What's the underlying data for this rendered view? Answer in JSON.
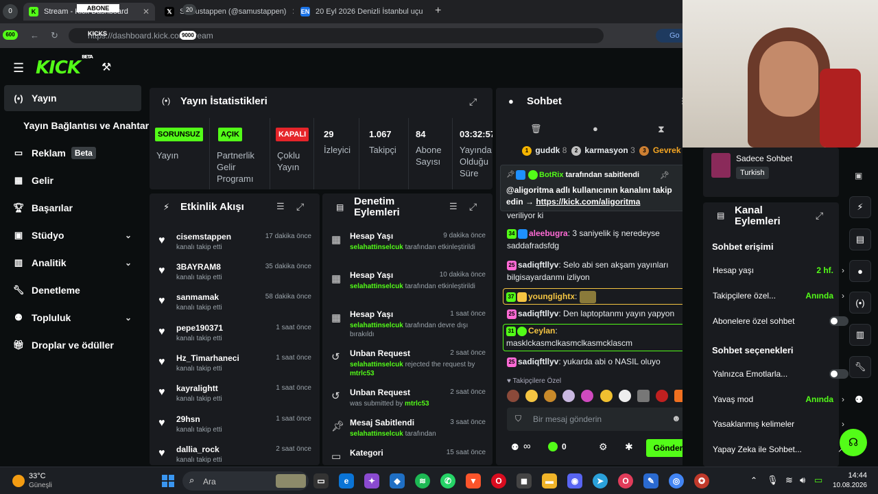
{
  "browser": {
    "tabs": [
      {
        "label": "Stream - Kick Dashboard",
        "icon": "kick-favicon"
      },
      {
        "label": "Samustappen (@samustappen)",
        "icon": "x-favicon"
      },
      {
        "label": "20 Eyl 2026 Denizli İstanbul uçu",
        "icon": "en-favicon"
      }
    ],
    "tab_counter": "0",
    "tab_counter2": "20",
    "overlay_abone": "ABONE",
    "url": "https://dashboard.kick.com/stream",
    "url_overlay_kicks": "KICKS",
    "url_overlay_num": "9000",
    "left_badge": "600",
    "extension_label": "Go"
  },
  "kick": {
    "logo": "KICK",
    "logo_beta": "BETA"
  },
  "sidebar": {
    "items": [
      {
        "label": "Yayın",
        "icon": "broadcast-icon"
      },
      {
        "label": "Yayın Bağlantısı ve Anahtarı"
      },
      {
        "label": "Reklam",
        "badge": "Beta",
        "icon": "ad-icon"
      },
      {
        "label": "Gelir",
        "icon": "revenue-icon"
      },
      {
        "label": "Başarılar",
        "icon": "trophy-icon"
      },
      {
        "label": "Stüdyo",
        "icon": "studio-icon"
      },
      {
        "label": "Analitik",
        "icon": "chart-icon"
      },
      {
        "label": "Denetleme",
        "icon": "wrench-icon"
      },
      {
        "label": "Topluluk",
        "icon": "community-icon"
      },
      {
        "label": "Droplar ve ödüller",
        "icon": "gift-icon"
      }
    ]
  },
  "stats": {
    "title": "Yayın İstatistikleri",
    "cols": [
      {
        "badge": "SORUNSUZ",
        "label": "Yayın",
        "badge_color": "#53fc18"
      },
      {
        "badge": "AÇIK",
        "label": "Partnerlik Gelir Programı",
        "badge_color": "#53fc18"
      },
      {
        "badge": "KAPALI",
        "label": "Çoklu Yayın",
        "badge_color": "#e5252a"
      },
      {
        "value": "29",
        "label": "İzleyici"
      },
      {
        "value": "1.067",
        "label": "Takipçi"
      },
      {
        "value": "84",
        "label": "Abone Sayısı"
      },
      {
        "value": "03:32:57",
        "label": "Yayında Olduğu Süre"
      }
    ]
  },
  "activity": {
    "title": "Etkinlik Akışı",
    "items": [
      {
        "name": "cisemstappen",
        "sub": "kanalı takip etti",
        "time": "17 dakika önce"
      },
      {
        "name": "3BAYRAM8",
        "sub": "kanalı takip etti",
        "time": "35 dakika önce"
      },
      {
        "name": "sanmamak",
        "sub": "kanalı takip etti",
        "time": "58 dakika önce"
      },
      {
        "name": "pepe190371",
        "sub": "kanalı takip etti",
        "time": "1 saat önce"
      },
      {
        "name": "Hz_Timarhaneci",
        "sub": "kanalı takip etti",
        "time": "1 saat önce"
      },
      {
        "name": "kayralightt",
        "sub": "kanalı takip etti",
        "time": "1 saat önce"
      },
      {
        "name": "29hsn",
        "sub": "kanalı takip etti",
        "time": "1 saat önce"
      },
      {
        "name": "dallia_rock",
        "sub": "kanalı takip etti",
        "time": "2 saat önce"
      }
    ]
  },
  "moderation": {
    "title": "Denetim Eylemleri",
    "items": [
      {
        "title": "Hesap Yaşı",
        "user": "selahattinselcuk",
        "rest": " tarafından etkinleştirildi",
        "time": "9 dakika önce",
        "icon": "calendar-icon"
      },
      {
        "title": "Hesap Yaşı",
        "user": "selahattinselcuk",
        "rest": " tarafından etkinleştirildi",
        "time": "10 dakika önce",
        "icon": "calendar-icon"
      },
      {
        "title": "Hesap Yaşı",
        "user": "selahattinselcuk",
        "rest": " tarafından devre dışı bırakıldı",
        "time": "1 saat önce",
        "icon": "calendar-icon"
      },
      {
        "title": "Unban Request",
        "user": "selahattinselcuk",
        "rest": " rejected the request by ",
        "user2": "mtrlc53",
        "time": "2 saat önce",
        "icon": "undo-icon"
      },
      {
        "title": "Unban Request",
        "pre": "was submitted by ",
        "user2": "mtrlc53",
        "time": "2 saat önce",
        "icon": "undo-icon"
      },
      {
        "title": "Mesaj Sabitlendi",
        "user": "selahattinselcuk",
        "rest": " tarafından",
        "time": "3 saat önce",
        "icon": "pin-icon"
      },
      {
        "title": "Kategori",
        "time": "15 saat önce",
        "icon": "category-icon"
      }
    ]
  },
  "chat": {
    "title": "Sohbet",
    "leaderboard": [
      {
        "rank": "1",
        "name": "guddk",
        "count": "8"
      },
      {
        "rank": "2",
        "name": "karmasyon",
        "count": "3"
      },
      {
        "rank": "3",
        "name": "Gevrek"
      }
    ],
    "pinned": {
      "by": "BotRix",
      "by_suffix": " tarafından sabitlendi",
      "text": "@aligoritma adlı kullanıcının kanalını takip edin → ",
      "link": "https://kick.com/aligoritma"
    },
    "messages": [
      {
        "user": "",
        "text": "veriliyor ki"
      },
      {
        "user": "aleebugra",
        "text": "3 saniyelik iş neredeyse saddafradsfdg",
        "color": "#ff6ad5",
        "badge": "34"
      },
      {
        "user": "sadiqftllyv",
        "text": "Selo abi sen akşam yayınları bilgisayardanmı izliyon",
        "color": "#ffffff",
        "badge": "25"
      },
      {
        "user": "younglightx",
        "text": "",
        "color": "#f5c542",
        "badge": "37"
      },
      {
        "user": "sadiqftllyv",
        "text": "Den laptoptanmı yayın yapyon",
        "color": "#ffffff",
        "badge": "25"
      },
      {
        "user": "Ceylan",
        "text": "masklckasmclkasmclkasmcklascm",
        "color": "#f5c542",
        "badge": "31"
      },
      {
        "user": "sadiqftllyv",
        "text": "yukarda abi o NASIL oluyo",
        "color": "#ffffff",
        "badge": "25"
      }
    ],
    "followers_only": "Takipçilere Özel",
    "input_placeholder": "Bir mesaj gönderin",
    "infinity_count": "0",
    "send_label": "Gönder"
  },
  "right": {
    "chat_only": "Sadece Sohbet",
    "language": "Turkish",
    "channel_actions_title": "Kanal Eylemleri",
    "chat_access_title": "Sohbet erişimi",
    "account_age_label": "Hesap yaşı",
    "account_age_value": "2 hf.",
    "followers_label": "Takipçilere özel...",
    "followers_value": "Anında",
    "subscribers_label": "Abonelere özel sohbet",
    "chat_options_title": "Sohbet seçenekleri",
    "emotes_label": "Yalnızca Emotlarla...",
    "slow_label": "Yavaş mod",
    "slow_value": "Anında",
    "banned_words_label": "Yasaklanmış kelimeler",
    "ai_label": "Yapay Zeka ile Sohbet..."
  },
  "taskbar": {
    "weather_temp": "33°C",
    "weather_desc": "Güneşli",
    "search_placeholder": "Ara",
    "time": "14:44",
    "date": "10.08.2026"
  }
}
